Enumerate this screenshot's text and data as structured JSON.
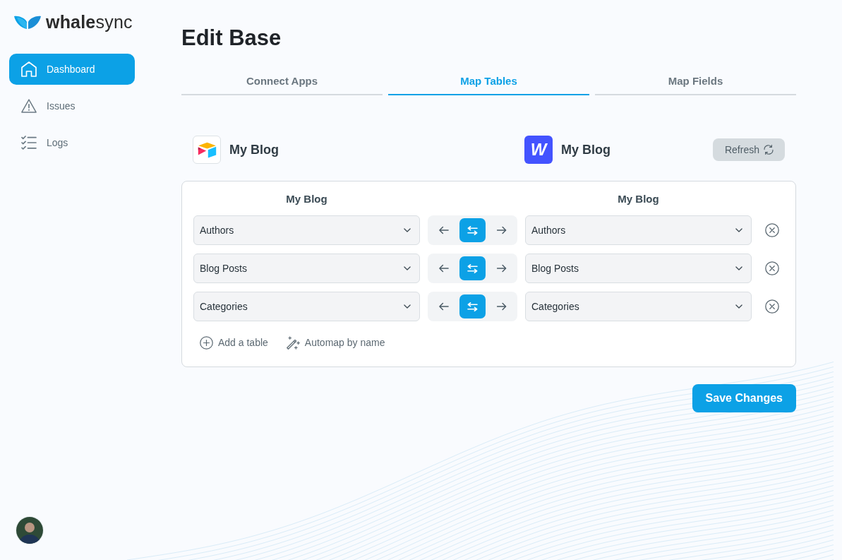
{
  "sidebar": {
    "logo": "**whale**sync",
    "items": [
      {
        "kind": "home",
        "label": "Dashboard",
        "selected": true
      },
      {
        "kind": "warning",
        "label": "Issues",
        "selected": false
      },
      {
        "kind": "checklist",
        "label": "Logs",
        "selected": false
      }
    ]
  },
  "page": {
    "title": "Edit Base"
  },
  "tabs": [
    {
      "label": "Connect Apps",
      "selected": false
    },
    {
      "label": "Map Tables",
      "selected": true
    },
    {
      "label": "Map Fields",
      "selected": false
    }
  ],
  "apps": [
    {
      "kind": "cube",
      "name": "My Blog"
    },
    {
      "kind": "letter",
      "logo": "W",
      "name": "My Blog"
    }
  ],
  "refresh_button": {
    "label": "Refresh"
  },
  "mapping": {
    "columns": [
      "My Blog",
      "My Blog"
    ],
    "rows": [
      {
        "left": "Authors",
        "right": "Authors",
        "sync": [
          {
            "kind": "left",
            "selected": false
          },
          {
            "kind": "both",
            "selected": true
          },
          {
            "kind": "right",
            "selected": false
          }
        ]
      },
      {
        "left": "Blog Posts",
        "right": "Blog Posts",
        "sync": [
          {
            "kind": "left",
            "selected": false
          },
          {
            "kind": "both",
            "selected": true
          },
          {
            "kind": "right",
            "selected": false
          }
        ]
      },
      {
        "left": "Categories",
        "right": "Categories",
        "sync": [
          {
            "kind": "left",
            "selected": false
          },
          {
            "kind": "both",
            "selected": true
          },
          {
            "kind": "right",
            "selected": false
          }
        ]
      }
    ],
    "actions": [
      {
        "kind": "add",
        "label": "Add a table"
      },
      {
        "kind": "automap",
        "label": "Automap by name"
      }
    ]
  },
  "save_button": {
    "label": "Save Changes"
  }
}
